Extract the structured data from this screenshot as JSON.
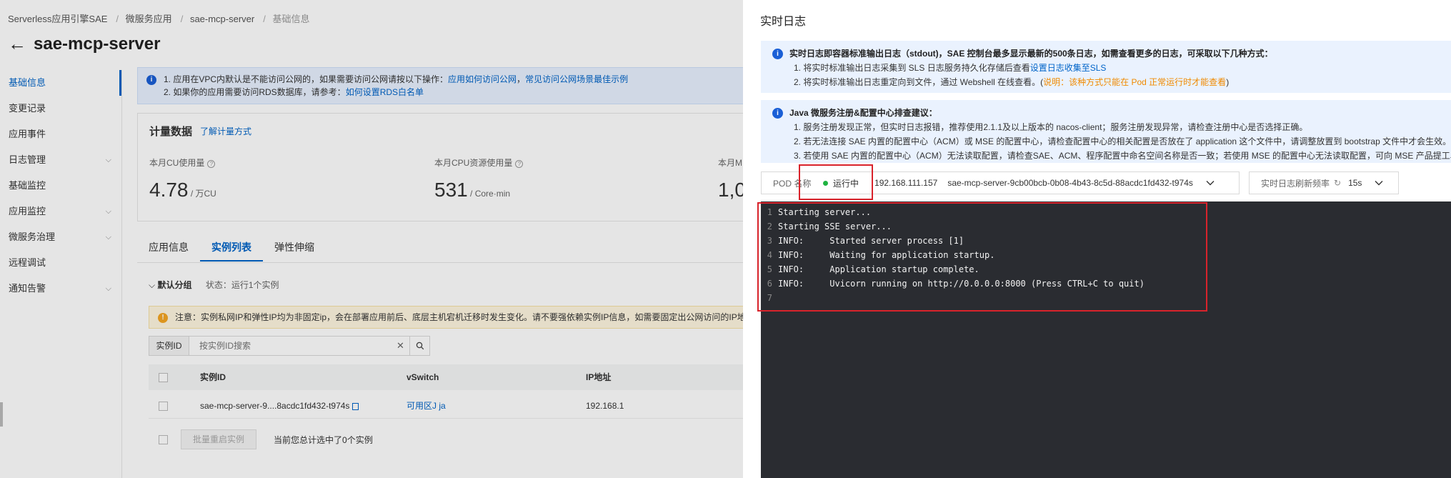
{
  "breadcrumb": [
    "Serverless应用引擎SAE",
    "微服务应用",
    "sae-mcp-server",
    "基础信息"
  ],
  "page_title": "sae-mcp-server",
  "sidebar": {
    "items": [
      {
        "label": "基础信息",
        "active": true
      },
      {
        "label": "变更记录"
      },
      {
        "label": "应用事件"
      },
      {
        "label": "日志管理",
        "expandable": true
      },
      {
        "label": "基础监控"
      },
      {
        "label": "应用监控",
        "expandable": true
      },
      {
        "label": "微服务治理",
        "expandable": true
      },
      {
        "label": "远程调试"
      },
      {
        "label": "通知告警",
        "expandable": true
      }
    ]
  },
  "notice": {
    "line1_prefix": "1. 应用在VPC内默认是不能访问公网的，如果需要访问公网请按以下操作：",
    "line1_link1": "应用如何访问公网",
    "line1_sep": "，",
    "line1_link2": "常见访问公网场景最佳示例",
    "line2_prefix": "2. 如果你的应用需要访问RDS数据库，请参考：",
    "line2_link": "如何设置RDS白名单"
  },
  "metrics": {
    "title": "计量数据",
    "link": "了解计量方式",
    "items": [
      {
        "label": "本月CU使用量",
        "value": "4.78",
        "unit": " / 万CU"
      },
      {
        "label": "本月CPU资源使用量",
        "value": "531",
        "unit": " / Core·min"
      },
      {
        "label": "本月M",
        "value": "1,0",
        "unit": ""
      }
    ]
  },
  "tabs": [
    "应用信息",
    "实例列表",
    "弹性伸缩"
  ],
  "group": {
    "name": "默认分组",
    "status": "状态：运行1个实例"
  },
  "warning": "注意：实例私网IP和弹性IP均为非固定ip，会在部署应用前后、底层主机宕机迁移时发生变化。请不要强依赖实例IP信息，如需要固定出公网访问的IP地址",
  "search": {
    "label": "实例ID",
    "placeholder": "按实例ID搜索"
  },
  "table": {
    "headers": [
      "实例ID",
      "vSwitch",
      "IP地址"
    ],
    "rows": [
      {
        "instance_id": "sae-mcp-server-9....8acdc1fd432-t974s",
        "vswitch": "可用区J ja",
        "ip": "192.168.1"
      }
    ]
  },
  "batch": {
    "button": "批量重启实例",
    "count_text": "当前您总计选中了0个实例"
  },
  "drawer": {
    "title": "实时日志",
    "alert1": {
      "head": "实时日志即容器标准输出日志（stdout)，SAE 控制台最多显示最新的500条日志，如需查看更多的日志，可采取以下几种方式：",
      "line1_prefix": "1. 将实时标准输出日志采集到 SLS 日志服务持久化存储后查看",
      "line1_link": "设置日志收集至SLS",
      "line2_prefix": "2. 将实时标准输出日志重定向到文件，通过 Webshell 在线查看。(",
      "line2_orange": "说明：该种方式只能在 Pod 正常运行时才能查看",
      "line2_suffix": ")"
    },
    "alert2": {
      "head": "Java 微服务注册&配置中心排查建议：",
      "line1": "1. 服务注册发现正常，但实时日志报错，推荐使用2.1.1及以上版本的 nacos-client；服务注册发现异常，请检查注册中心是否选择正确。",
      "line2": "2. 若无法连接 SAE 内置的配置中心（ACM）或 MSE 的配置中心，请检查配置中心的相关配置是否放在了 application 这个文件中，请调整放置到 bootstrap 文件中才会生效。",
      "line3": "3. 若使用 SAE 内置的配置中心（ACM）无法读取配置，请检查SAE、ACM、程序配置中命名空间名称是否一致；若使用 MSE 的配置中心无法读取配置，可向 MSE 产品提工单"
    },
    "pod": {
      "label": "POD 名称",
      "status": "运行中",
      "ip": "192.168.111.157",
      "name": "sae-mcp-server-9cb00bcb-0b08-4b43-8c5d-88acdc1fd432-t974s"
    },
    "refresh": {
      "label": "实时日志刷新频率",
      "value": "15s"
    },
    "log_lines": [
      "Starting server...",
      "Starting SSE server...",
      "INFO:     Started server process [1]",
      "INFO:     Waiting for application startup.",
      "INFO:     Application startup complete.",
      "INFO:     Uvicorn running on http://0.0.0.0:8000 (Press CTRL+C to quit)",
      ""
    ]
  },
  "colors": {
    "accent": "#0064c8",
    "status_running": "#1fb341",
    "highlight_box": "#d9232b",
    "terminal_bg": "#2a2c31"
  }
}
